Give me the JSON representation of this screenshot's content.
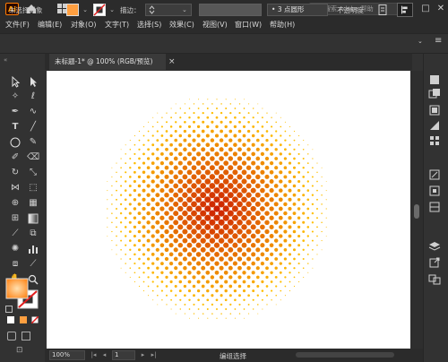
{
  "app": {
    "logo": "Ai",
    "search_placeholder": "搜索 Adobe 帮助",
    "window_controls": [
      "minimize-icon",
      "maximize-icon",
      "close-icon"
    ]
  },
  "menu": {
    "items": [
      "文件(F)",
      "编辑(E)",
      "对象(O)",
      "文字(T)",
      "选择(S)",
      "效果(C)",
      "视图(V)",
      "窗口(W)",
      "帮助(H)"
    ]
  },
  "control_bar": {
    "selection_status": "未选择对象",
    "fill_color": "#ff9f40",
    "stroke_label": "描边：",
    "brush_label": "3 点圆形",
    "opacity_label": "不透明度"
  },
  "document": {
    "tab_title": "未标题-1* @ 100% (RGB/预览)",
    "close_glyph": "×"
  },
  "artwork": {
    "type": "halftone-dots",
    "center_color": "#cc1f00",
    "edge_color": "#ffbf00"
  },
  "status_bar": {
    "zoom": "100%",
    "artboard": "1",
    "status": "编组选择"
  },
  "colors": {
    "accent": "#ff7c00",
    "fill_swatch": "#ff9f40"
  }
}
